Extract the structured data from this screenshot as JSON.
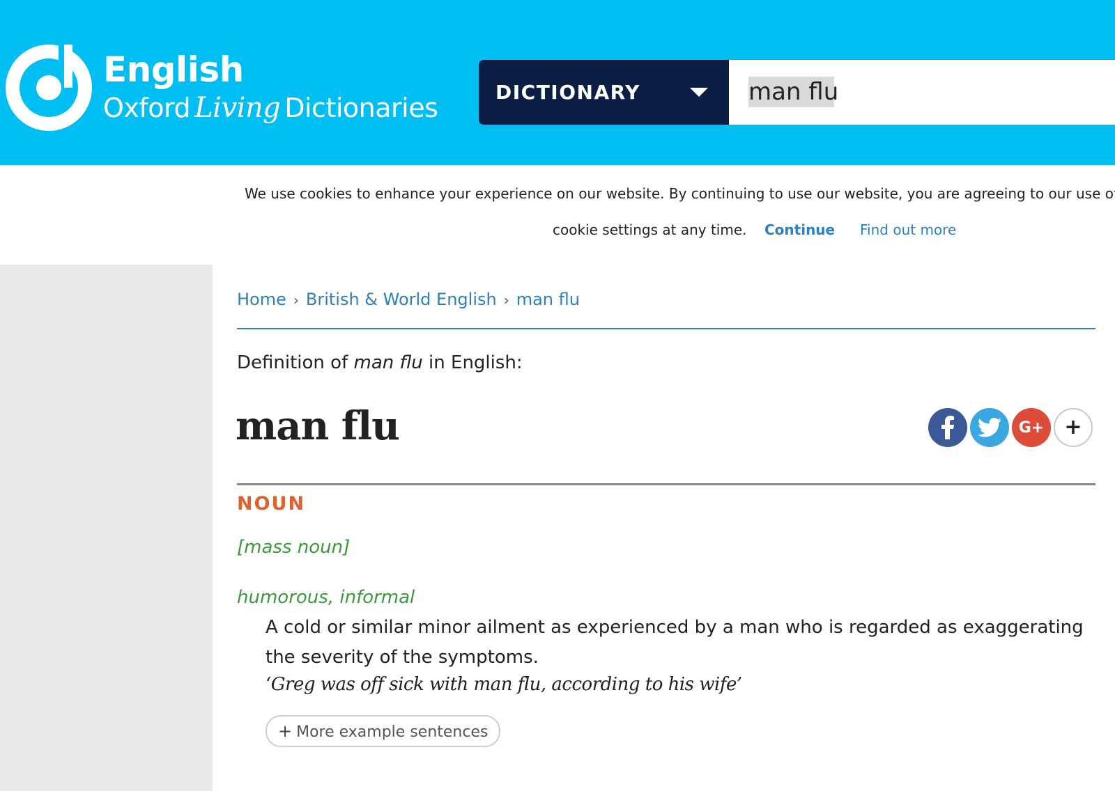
{
  "header": {
    "brand_line1": "English",
    "brand_line2_pre": "Oxford",
    "brand_line2_living": "Living",
    "brand_line2_post": "Dictionaries",
    "dictionary_select_label": "DICTIONARY",
    "search_value": "man flu",
    "background_color": "#00bdf2",
    "select_color": "#0b1f44"
  },
  "cookie_banner": {
    "line1": "We use cookies to enhance your experience on our website. By continuing to use our website, you are agreeing to our use of cookie",
    "line2": "cookie settings at any time.",
    "continue_label": "Continue",
    "find_out_more_label": "Find out more",
    "link_color": "#2e7fc1"
  },
  "breadcrumb": {
    "items": [
      "Home",
      "British & World English",
      "man flu"
    ],
    "separator": "›"
  },
  "entry": {
    "definition_of_pre": "Definition of ",
    "definition_of_term": "man flu",
    "definition_of_post": " in English:",
    "headword": "man flu",
    "part_of_speech": "NOUN",
    "grammar": "[mass noun]",
    "register": "humorous, informal",
    "definition": "A cold or similar minor ailment as experienced by a man who is regarded as exaggerating the severity of the symptoms.",
    "example": "‘Greg was off sick with man flu, according to his wife’",
    "more_examples_label": "More example sentences",
    "pos_color": "#e0612c",
    "label_color": "#3a9a3a"
  },
  "share": {
    "buttons": [
      {
        "name": "facebook",
        "icon": "facebook-icon",
        "glyph": "f",
        "color": "#3b5998"
      },
      {
        "name": "twitter",
        "icon": "twitter-icon",
        "glyph": "",
        "color": "#3aa7e0"
      },
      {
        "name": "google-plus",
        "icon": "google-plus-icon",
        "glyph": "G+",
        "color": "#dd4b39"
      },
      {
        "name": "more",
        "icon": "plus-icon",
        "glyph": "+",
        "color": "#ffffff"
      }
    ]
  }
}
